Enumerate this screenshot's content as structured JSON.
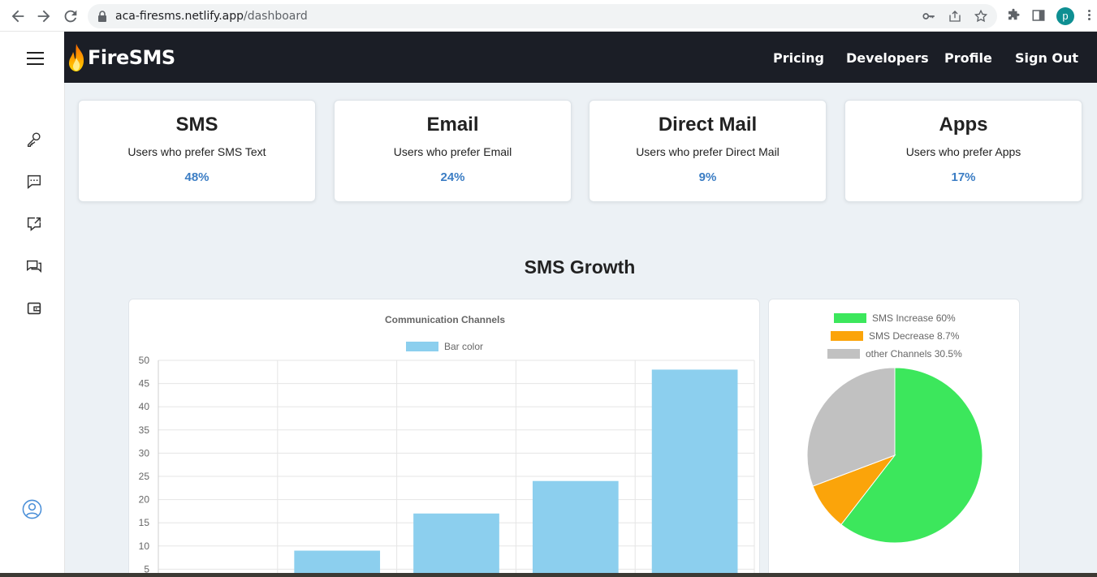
{
  "browser": {
    "url_host": "aca-firesms.netlify.app",
    "url_path": "/dashboard",
    "profile_initial": "p",
    "icons": [
      "back-icon",
      "forward-icon",
      "reload-icon",
      "lock-icon",
      "key-icon",
      "share-icon",
      "star-icon",
      "extensions-icon",
      "side-panel-icon",
      "menu-icon"
    ]
  },
  "brand": {
    "name": "FireSMS",
    "flame_colors": [
      "#ff6a00",
      "#ffd200"
    ]
  },
  "nav": {
    "links": [
      "Pricing",
      "Developers",
      "Profile",
      "Sign Out"
    ]
  },
  "sidebar": {
    "icons": [
      "hamburger-icon",
      "key-icon",
      "message-icon",
      "message-forward-icon",
      "chat-bubbles-icon",
      "wallet-icon",
      "user-circle-icon"
    ]
  },
  "cards": [
    {
      "title": "SMS",
      "desc": "Users who prefer SMS Text",
      "value": "48%"
    },
    {
      "title": "Email",
      "desc": "Users who prefer Email",
      "value": "24%"
    },
    {
      "title": "Direct Mail",
      "desc": "Users who prefer Direct Mail",
      "value": "9%"
    },
    {
      "title": "Apps",
      "desc": "Users who prefer Apps",
      "value": "17%"
    }
  ],
  "section": {
    "title": "SMS Growth"
  },
  "colors": {
    "accent": "#3b7dc4",
    "nav_bg": "#1b1e26",
    "page_bg": "#ecf1f5"
  },
  "chart_data": [
    {
      "type": "bar",
      "title": "Communication Channels",
      "legend": [
        {
          "label": "Bar color",
          "color": "#8ccfee"
        }
      ],
      "legend_position": "top",
      "values": [
        0,
        9,
        17,
        24,
        48
      ],
      "ylim": [
        5,
        50
      ],
      "yticks": [
        5,
        10,
        15,
        20,
        25,
        30,
        35,
        40,
        45,
        50
      ],
      "grid": true
    },
    {
      "type": "pie",
      "legend_position": "top",
      "slices": [
        {
          "label": "SMS Increase 60%",
          "value": 60,
          "color": "#3ce75c"
        },
        {
          "label": "SMS Decrease 8.7%",
          "value": 8.7,
          "color": "#fba40a"
        },
        {
          "label": "other Channels 30.5%",
          "value": 30.5,
          "color": "#c1c1c1"
        }
      ]
    }
  ]
}
